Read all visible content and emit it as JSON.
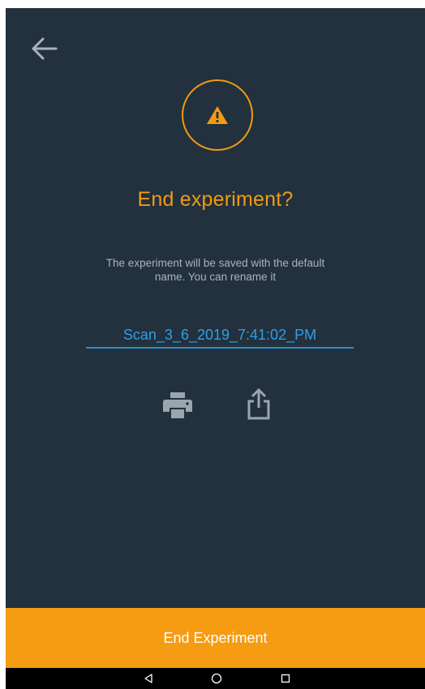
{
  "dialog": {
    "title": "End experiment?",
    "message": "The experiment will be saved with the default name. You can rename it",
    "experiment_name": "Scan_3_6_2019_7:41:02_PM"
  },
  "icons": {
    "back": "arrow-back-icon",
    "warning": "warning-triangle-icon",
    "print": "printer-icon",
    "share": "share-upload-icon"
  },
  "primary_button": {
    "label": "End Experiment"
  },
  "nav_bar": {
    "buttons": [
      "back-triangle",
      "home-circle",
      "recents-square"
    ]
  },
  "colors": {
    "background": "#22313d",
    "accent": "#f29a12",
    "link": "#2f9ee5",
    "muted_text": "#a9b3ba",
    "icon_gray": "#9aa6ae"
  }
}
